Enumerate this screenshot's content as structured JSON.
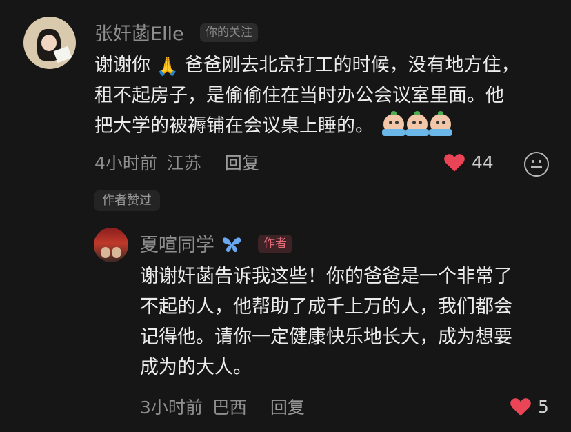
{
  "comment1": {
    "username": "张奸菡Elle",
    "relation_tag": "你的关注",
    "line1_a": "谢谢你",
    "line1_b": "爸爸刚去北京打工的时候，没有地方住，",
    "line2": "租不起房子，是偷偷住在当时办公会议室里面。他",
    "line3": "把大学的被褥铺在会议桌上睡的。",
    "time": "4小时前",
    "location": "江苏",
    "reply_label": "回复",
    "likes": "44",
    "author_liked": "作者赞过",
    "icons": [
      "pray-emoji",
      "crying-emoji",
      "heart-icon",
      "emoji-icon"
    ]
  },
  "reply": {
    "username": "夏喧同学",
    "author_tag": "作者",
    "line1": "谢谢奸菡告诉我这些！你的爸爸是一个非常了",
    "line2": "不起的人，他帮助了成千上万的人，我们都会",
    "line3": "记得他。请你一定健康快乐地长大，成为想要",
    "line4": "成为的大人。",
    "time": "3小时前",
    "location": "巴西",
    "reply_label": "回复",
    "likes": "5",
    "icons": [
      "butterfly-icon",
      "heart-icon"
    ]
  },
  "colors": {
    "background": "#161616",
    "heart": "#e94556",
    "author_tag": "#e36a78",
    "butterfly": "#6aa9f2"
  }
}
